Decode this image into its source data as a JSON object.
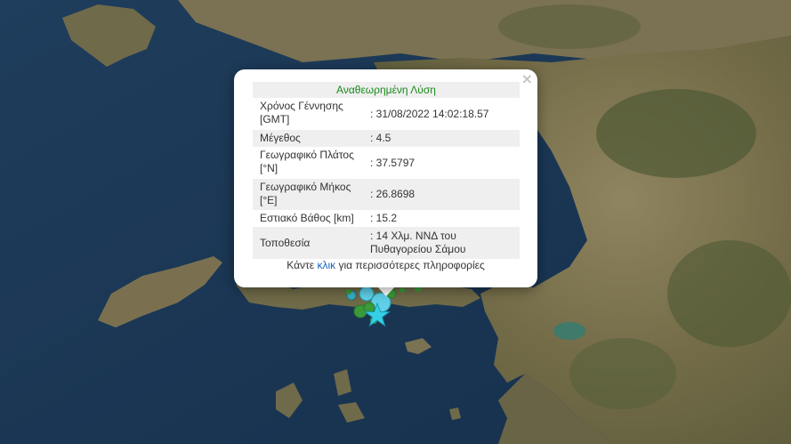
{
  "popup": {
    "close_symbol": "×",
    "title": "Αναθεωρημένη Λύση",
    "rows": [
      {
        "label": "Χρόνος Γέννησης [GMT]",
        "value": ": 31/08/2022 14:02:18.57"
      },
      {
        "label": "Μέγεθος",
        "value": ": 4.5"
      },
      {
        "label": "Γεωγραφικό Πλάτος [°N]",
        "value": ": 37.5797"
      },
      {
        "label": "Γεωγραφικό Μήκος [°E]",
        "value": ": 26.8698"
      },
      {
        "label": "Εστιακό Βάθος [km]",
        "value": ": 15.2"
      },
      {
        "label": "Τοποθεσία",
        "value": ": 14 Χλμ. ΝΝΔ του Πυθαγορείου Σάμου"
      }
    ],
    "more_prefix": "Κάντε ",
    "more_link": "κλικ",
    "more_suffix": " για περισσότερες πληροφορίες"
  },
  "map": {
    "colors": {
      "sea": "#1a3553",
      "land": "#8a7d5a",
      "vegetation": "#4a5a30",
      "event_circle": "#5fd0e8",
      "event_older": "#3a9a3a",
      "epicenter_star": "#35d0e8"
    }
  }
}
